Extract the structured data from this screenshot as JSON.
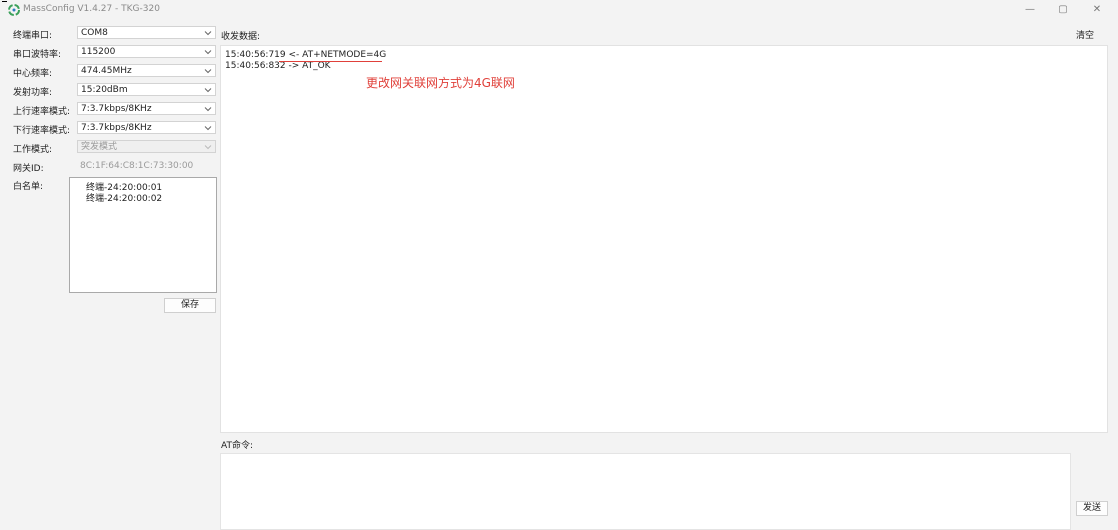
{
  "window": {
    "title": "MassConfig V1.4.27 - TKG-320",
    "app_icon": "massconfig-logo-icon",
    "controls": {
      "minimize": "—",
      "maximize": "▢",
      "close": "✕"
    }
  },
  "settings": {
    "serial_port": {
      "label": "终端串口:",
      "value": "COM8"
    },
    "baud_rate": {
      "label": "串口波特率:",
      "value": "115200"
    },
    "center_frequency": {
      "label": "中心频率:",
      "value": "474.45MHz"
    },
    "tx_power": {
      "label": "发射功率:",
      "value": "15:20dBm"
    },
    "uplink_rate_mode": {
      "label": "上行速率模式:",
      "value": "7:3.7kbps/8KHz"
    },
    "downlink_rate_mode": {
      "label": "下行速率模式:",
      "value": "7:3.7kbps/8KHz"
    },
    "work_mode": {
      "label": "工作模式:",
      "value": "突发模式"
    },
    "gateway_id": {
      "label": "网关ID:",
      "value": "8C:1F:64:C8:1C:73:30:00"
    },
    "whitelist": {
      "label": "白名单:",
      "items": [
        "终端-24:20:00:01",
        "终端-24:20:00:02"
      ]
    },
    "save_label": "保存"
  },
  "receive": {
    "label": "收发数据:",
    "clear_label": "清空",
    "lines": [
      "15:40:56:719 <- AT+NETMODE=4G",
      "15:40:56:832 -> AT_OK"
    ],
    "annotation": "更改网关联网方式为4G联网",
    "annotation_color": "#e0403a"
  },
  "at_command": {
    "label": "AT命令:",
    "value": "",
    "send_label": "发送"
  }
}
